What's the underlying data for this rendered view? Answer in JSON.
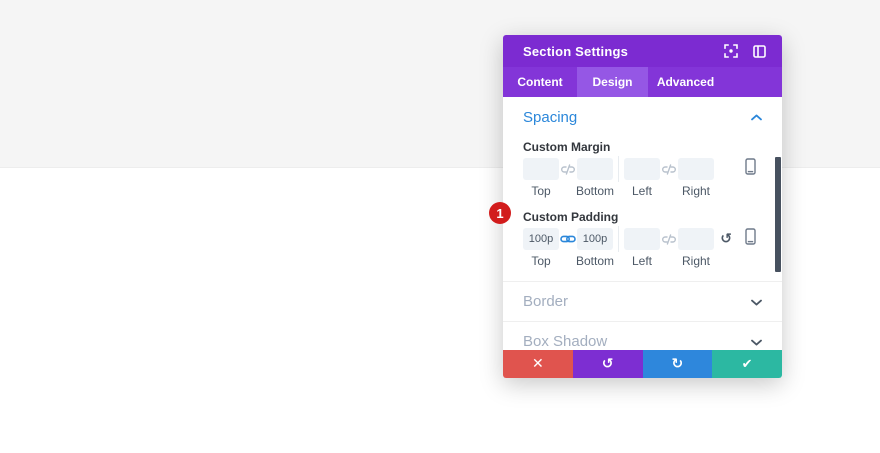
{
  "window": {
    "title": "Section Settings"
  },
  "header_icons": {
    "left": "expand-icon",
    "right": "sidebar-toggle-icon"
  },
  "tabs": [
    {
      "label": "Content",
      "active": false
    },
    {
      "label": "Design",
      "active": true
    },
    {
      "label": "Advanced",
      "active": false
    }
  ],
  "spacing": {
    "title": "Spacing",
    "state": "expanded",
    "margin": {
      "label": "Custom Margin",
      "fields": [
        {
          "label": "Top",
          "value": ""
        },
        {
          "label": "Bottom",
          "value": ""
        },
        {
          "label": "Left",
          "value": ""
        },
        {
          "label": "Right",
          "value": ""
        }
      ],
      "top_bottom_linked": false,
      "left_right_linked": false
    },
    "padding": {
      "label": "Custom Padding",
      "fields": [
        {
          "label": "Top",
          "value": "100p"
        },
        {
          "label": "Bottom",
          "value": "100p"
        },
        {
          "label": "Left",
          "value": ""
        },
        {
          "label": "Right",
          "value": ""
        }
      ],
      "top_bottom_linked": true,
      "left_right_linked": false
    }
  },
  "collapsed_sections": [
    {
      "title": "Border"
    },
    {
      "title": "Box Shadow"
    }
  ],
  "footer": {
    "buttons": [
      {
        "name": "discard",
        "icon": "✕"
      },
      {
        "name": "undo",
        "icon": "↺"
      },
      {
        "name": "redo",
        "icon": "↻"
      },
      {
        "name": "save",
        "icon": "✔"
      }
    ]
  },
  "annotation_badge": {
    "value": "1"
  },
  "reset_glyph": "↺",
  "colors": {
    "page_band": "#f5f5f5",
    "header_purple": "#7c2bd1",
    "tabbar_purple": "#8335d8",
    "active_tab_purple": "#9557e5",
    "accent_blue": "#2b87da",
    "muted_heading": "#a3aebf",
    "input_bg": "#eff3f7",
    "scrollbar": "#47515f",
    "button_red": "#e0544e",
    "button_purple": "#7d2ed2",
    "button_blue": "#2e87dc",
    "button_teal": "#2cb8a2",
    "badge_red": "#d21c1c"
  }
}
